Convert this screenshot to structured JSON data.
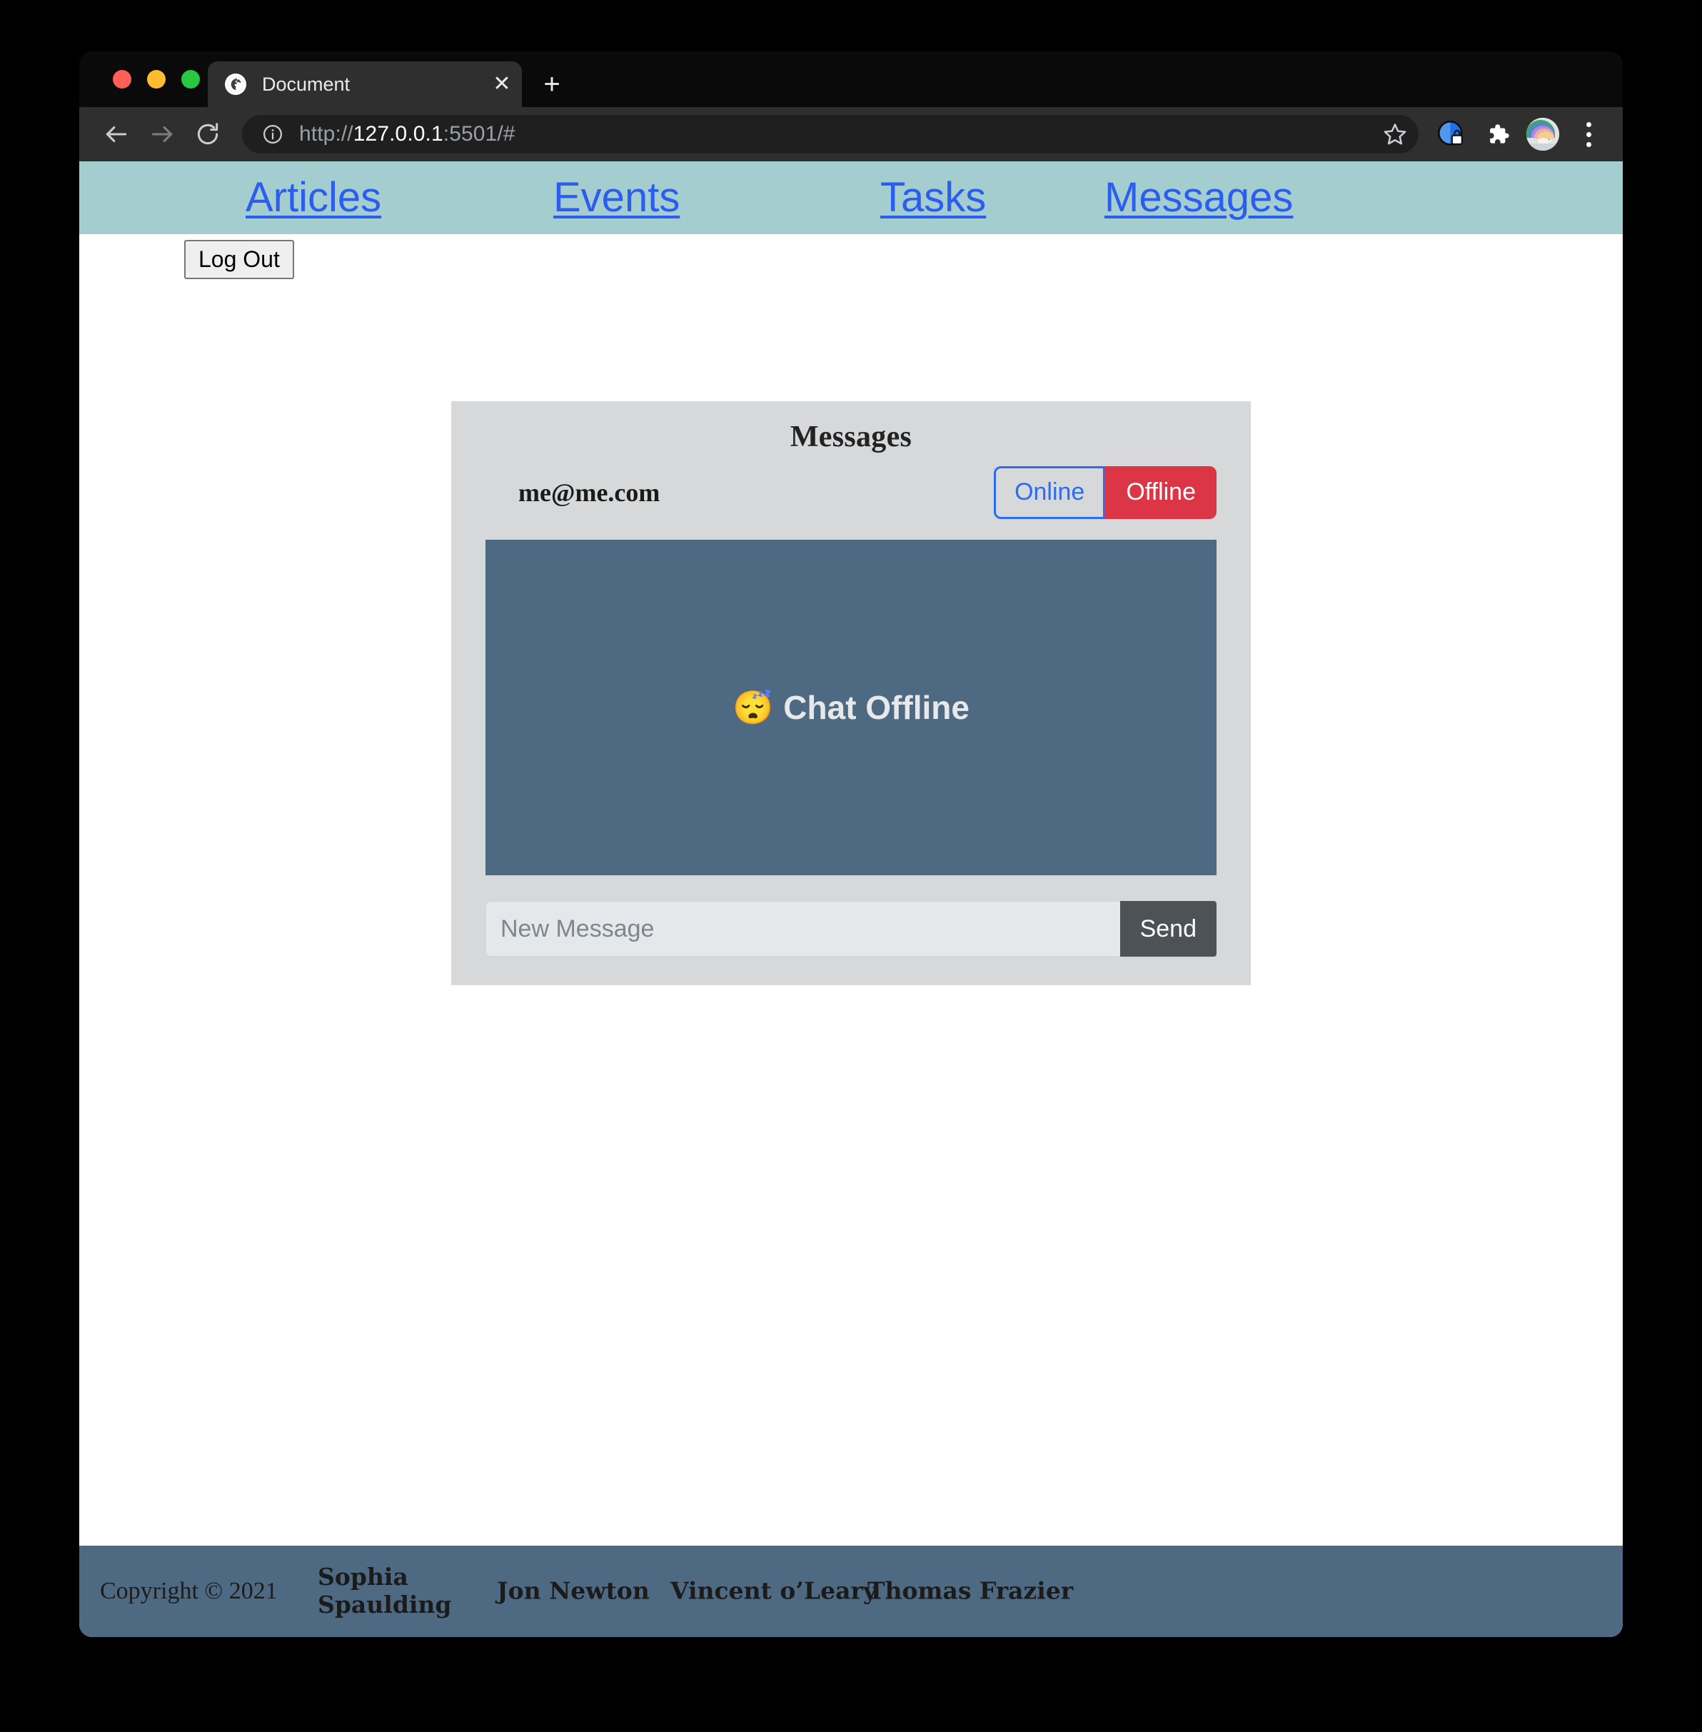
{
  "browser": {
    "tab": {
      "title": "Document",
      "favicon_icon": "globe-icon",
      "close_label": "✕"
    },
    "new_tab_label": "+",
    "toolbar": {
      "back_icon": "arrow-left-icon",
      "forward_icon": "arrow-right-icon",
      "reload_icon": "reload-icon",
      "info_icon": "info-circle-icon",
      "url_scheme": "http://",
      "url_host": "127.0.0.1",
      "url_rest": ":5501/#",
      "url_full": "http://127.0.0.1:5501/#",
      "star_icon": "star-icon",
      "privacy_icon": "privacy-badge-icon",
      "extensions_icon": "puzzle-piece-icon",
      "avatar_icon": "profile-avatar-icon",
      "menu_icon": "three-dot-menu-icon"
    },
    "window_controls": {
      "close": "close-traffic-light",
      "minimize": "minimize-traffic-light",
      "maximize": "maximize-traffic-light"
    }
  },
  "site_nav": {
    "links": [
      {
        "label": "Articles"
      },
      {
        "label": "Events"
      },
      {
        "label": "Tasks"
      },
      {
        "label": "Messages"
      }
    ]
  },
  "logout": {
    "label": "Log Out"
  },
  "card": {
    "title": "Messages",
    "user_email": "me@me.com",
    "status_buttons": {
      "online_label": "Online",
      "offline_label": "Offline"
    },
    "chat": {
      "emoji": "😴",
      "status_text": "Chat Offline"
    },
    "compose": {
      "placeholder": "New Message",
      "value": "",
      "send_label": "Send"
    }
  },
  "footer": {
    "copyright": "Copyright © 2021",
    "names": [
      "Sophia Spaulding",
      "Jon Newton",
      "Vincent o’Leary",
      "Thomas Frazier"
    ]
  },
  "colors": {
    "nav_background": "#a3cdce",
    "nav_link": "#2b5ef0",
    "card_background": "#d6d8da",
    "chat_background": "#4e6a83",
    "footer_background": "#4e6a83",
    "offline_red": "#dc3545",
    "online_blue": "#2b6cf0",
    "send_gray": "#4d5256"
  }
}
